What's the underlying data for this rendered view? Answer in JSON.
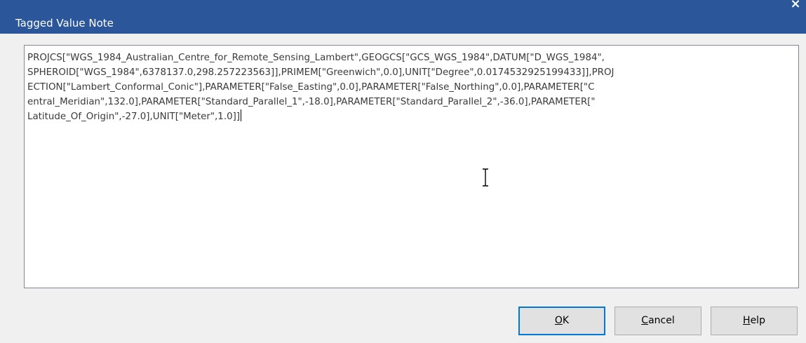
{
  "window": {
    "title": "Tagged Value Note",
    "close_glyph": "×"
  },
  "note": {
    "lines": [
      "PROJCS[\"WGS_1984_Australian_Centre_for_Remote_Sensing_Lambert\",GEOGCS[\"GCS_WGS_1984\",DATUM[\"D_WGS_1984\",",
      "SPHEROID[\"WGS_1984\",6378137.0,298.257223563]],PRIMEM[\"Greenwich\",0.0],UNIT[\"Degree\",0.0174532925199433]],PROJ",
      "ECTION[\"Lambert_Conformal_Conic\"],PARAMETER[\"False_Easting\",0.0],PARAMETER[\"False_Northing\",0.0],PARAMETER[\"C",
      "entral_Meridian\",132.0],PARAMETER[\"Standard_Parallel_1\",-18.0],PARAMETER[\"Standard_Parallel_2\",-36.0],PARAMETER[\"",
      "Latitude_Of_Origin\",-27.0],UNIT[\"Meter\",1.0]]"
    ]
  },
  "buttons": {
    "ok": {
      "mnemonic": "O",
      "rest": "K"
    },
    "cancel": {
      "mnemonic": "C",
      "rest": "ancel"
    },
    "help": {
      "mnemonic": "H",
      "rest": "elp"
    }
  },
  "icons": {
    "close": "close-icon",
    "cursor": "ibeam-cursor-icon"
  },
  "colors": {
    "titlebar": "#2b579a",
    "dialog_bg": "#f0f0f0",
    "button_bg": "#e1e1e1",
    "default_button_border": "#0078d7"
  }
}
